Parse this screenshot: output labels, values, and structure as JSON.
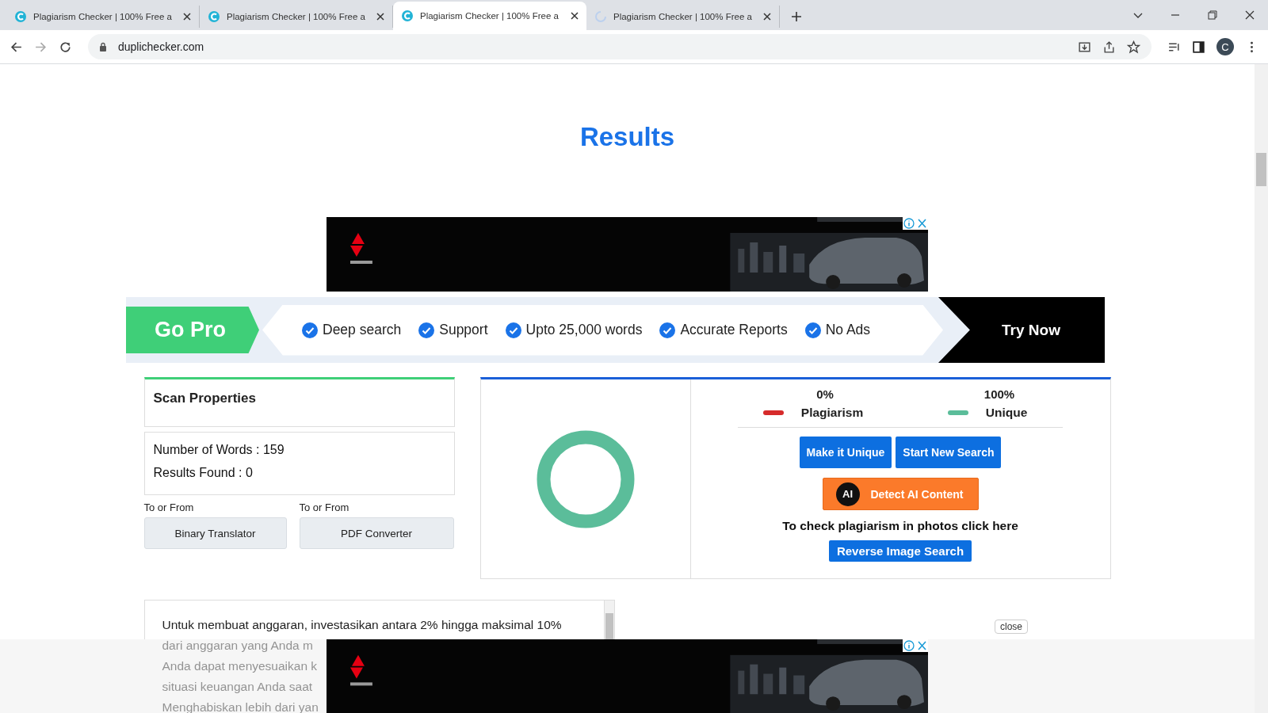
{
  "browser": {
    "tabs": [
      {
        "title": "Plagiarism Checker | 100% Free a",
        "selected": false,
        "loading": false
      },
      {
        "title": "Plagiarism Checker | 100% Free a",
        "selected": false,
        "loading": false
      },
      {
        "title": "Plagiarism Checker | 100% Free a",
        "selected": true,
        "loading": false
      },
      {
        "title": "Plagiarism Checker | 100% Free a",
        "selected": false,
        "loading": true
      }
    ],
    "url": "duplichecker.com",
    "profile_initial": "C"
  },
  "page": {
    "heading": "Results",
    "pro_banner": {
      "label": "Go Pro",
      "features": [
        "Deep search",
        "Support",
        "Upto 25,000 words",
        "Accurate Reports",
        "No Ads"
      ],
      "button": "Try Now"
    },
    "scan_properties": {
      "title": "Scan Properties",
      "stats": [
        "Number of Words : 159",
        "Results Found : 0"
      ]
    },
    "tools": [
      {
        "caption": "To or From",
        "button": "Binary Translator"
      },
      {
        "caption": "To or From",
        "button": "PDF Converter"
      }
    ],
    "results": {
      "legend": [
        {
          "percent": "0%",
          "label": "Plagiarism",
          "color": "#d62b2b"
        },
        {
          "percent": "100%",
          "label": "Unique",
          "color": "#5bbd9a"
        }
      ],
      "buttons": [
        "Make it Unique",
        "Start New Search"
      ],
      "ai_badge": "AI",
      "ai_button": "Detect AI Content",
      "photo_note": "To check plagiarism in photos click here",
      "reverse_button": "Reverse Image Search"
    },
    "text_box": {
      "lines": [
        "Untuk membuat anggaran, investasikan antara 2% hingga maksimal 10%",
        "dari anggaran yang Anda m",
        "Anda dapat menyesuaikan k",
        "situasi keuangan Anda saat",
        "Menghabiskan lebih dari yan"
      ]
    },
    "close_button": "close"
  }
}
